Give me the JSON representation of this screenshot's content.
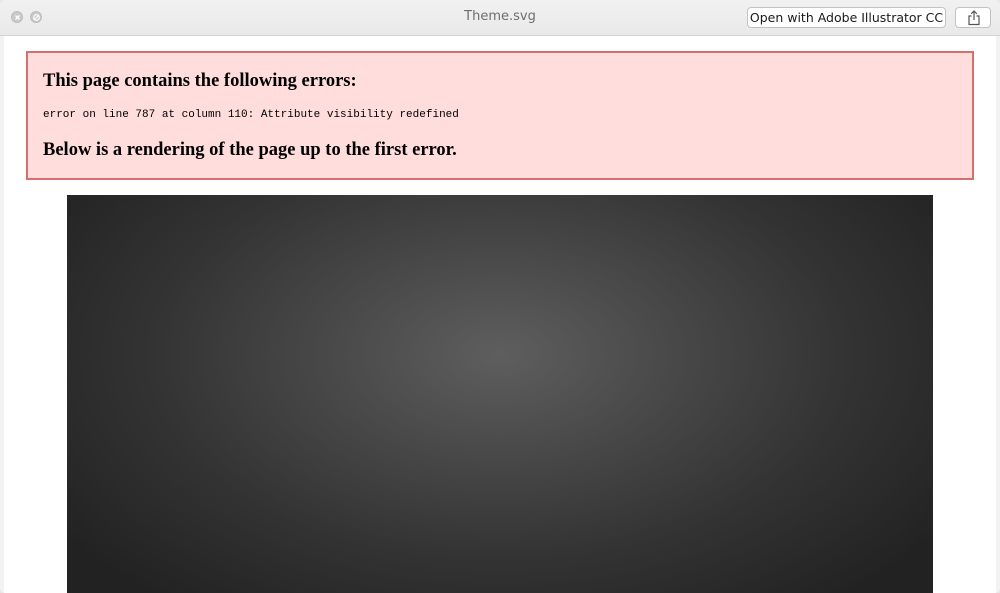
{
  "window": {
    "title": "Theme.svg"
  },
  "toolbar": {
    "open_with_label": "Open with Adobe Illustrator CC"
  },
  "error": {
    "heading": "This page contains the following errors:",
    "message": "error on line 787 at column 110: Attribute visibility redefined",
    "footer": "Below is a rendering of the page up to the first error."
  },
  "colors": {
    "error_background": "#ffdddd",
    "error_border": "#d67070",
    "render_center": "#5e5e5e",
    "render_edge": "#222222"
  }
}
